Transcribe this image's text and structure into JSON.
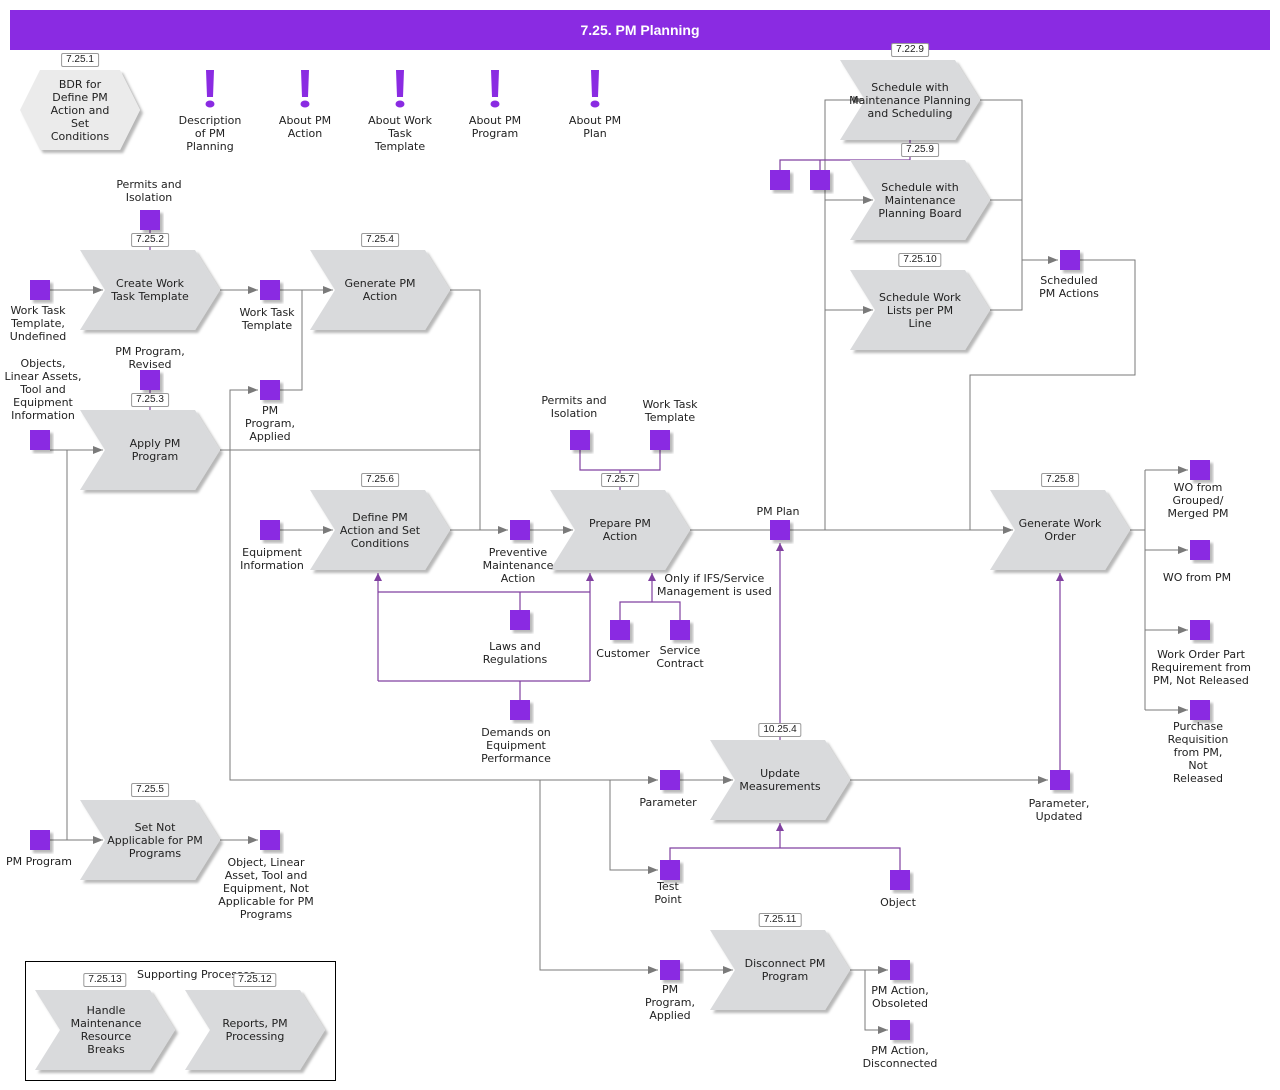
{
  "window": {
    "title": "7.25. PM Planning"
  },
  "colors": {
    "accent": "#8a2be2",
    "process_fill": "#d9dadc",
    "flow_line": "#7a7a7a",
    "info_flow_line": "#8040a0"
  },
  "bdr": {
    "id": "7.25.1",
    "label": "BDR for\nDefine PM\nAction and\nSet\nConditions"
  },
  "notes": [
    {
      "label": "Description\nof PM\nPlanning",
      "icon": "exclamation-icon"
    },
    {
      "label": "About PM\nAction",
      "icon": "exclamation-icon"
    },
    {
      "label": "About Work\nTask\nTemplate",
      "icon": "exclamation-icon"
    },
    {
      "label": "About PM\nProgram",
      "icon": "exclamation-icon"
    },
    {
      "label": "About PM\nPlan",
      "icon": "exclamation-icon"
    }
  ],
  "processes": [
    {
      "id": "7.25.2",
      "label": "Create Work\nTask Template"
    },
    {
      "id": "7.25.4",
      "label": "Generate PM\nAction"
    },
    {
      "id": "7.25.3",
      "label": "Apply PM\nProgram"
    },
    {
      "id": "7.25.6",
      "label": "Define PM\nAction and Set\nConditions"
    },
    {
      "id": "7.25.7",
      "label": "Prepare PM\nAction"
    },
    {
      "id": "7.25.8",
      "label": "Generate Work\nOrder"
    },
    {
      "id": "7.22.9",
      "label": "Schedule with\nMaintenance Planning\nand Scheduling"
    },
    {
      "id": "7.25.9",
      "label": "Schedule with\nMaintenance\nPlanning Board"
    },
    {
      "id": "7.25.10",
      "label": "Schedule Work\nLists per PM\nLine"
    },
    {
      "id": "7.25.5",
      "label": "Set Not\nApplicable for PM\nPrograms"
    },
    {
      "id": "10.25.4",
      "label": "Update\nMeasurements"
    },
    {
      "id": "7.25.11",
      "label": "Disconnect PM\nProgram"
    },
    {
      "id": "7.25.13",
      "label": "Handle\nMaintenance\nResource\nBreaks"
    },
    {
      "id": "7.25.12",
      "label": "Reports, PM\nProcessing"
    }
  ],
  "data_objects": [
    {
      "label": "Permits and\nIsolation"
    },
    {
      "label": "Work Task\nTemplate,\nUndefined"
    },
    {
      "label": "Work Task\nTemplate"
    },
    {
      "label": "PM Program,\nRevised"
    },
    {
      "label": "Objects,\nLinear Assets,\nTool and\nEquipment\nInformation"
    },
    {
      "label": "PM\nProgram,\nApplied"
    },
    {
      "label": "Equipment\nInformation"
    },
    {
      "label": "Preventive\nMaintenance\nAction"
    },
    {
      "label": "Permits and\nIsolation"
    },
    {
      "label": "Work Task\nTemplate"
    },
    {
      "label": "Laws and\nRegulations"
    },
    {
      "label": "Demands on\nEquipment\nPerformance"
    },
    {
      "label": "Customer"
    },
    {
      "label": "Service\nContract"
    },
    {
      "label": "PM Plan"
    },
    {
      "label": "Scheduled\nPM Actions"
    },
    {
      "label": "WO from\nGrouped/\nMerged PM"
    },
    {
      "label": "WO from PM"
    },
    {
      "label": "Work Order Part\nRequirement from\nPM, Not Released"
    },
    {
      "label": "Purchase\nRequisition\nfrom PM,\nNot\nReleased"
    },
    {
      "label": "PM Program"
    },
    {
      "label": "Object, Linear\nAsset, Tool and\nEquipment, Not\nApplicable for PM\nPrograms"
    },
    {
      "label": "Parameter"
    },
    {
      "label": "Parameter,\nUpdated"
    },
    {
      "label": "Test\nPoint"
    },
    {
      "label": "Object"
    },
    {
      "label": "PM\nProgram,\nApplied"
    },
    {
      "label": "PM Action,\nObsoleted"
    },
    {
      "label": "PM Action,\nDisconnected"
    }
  ],
  "annotation": "Only if IFS/Service\nManagement is used",
  "supporting": {
    "title": "Supporting Processes"
  }
}
